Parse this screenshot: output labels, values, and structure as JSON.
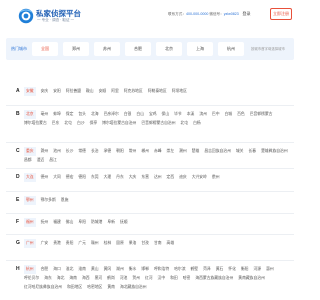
{
  "header": {
    "title": "私家侦探平台",
    "subtitle": "一 专业 · 调查 · 取证 一",
    "contact_prefix": "联系方式：",
    "phone": "400-000-0000",
    "email_prefix": "  微信号：",
    "email": "yzlw0823",
    "login_label": "登录",
    "register_label": "立即注册"
  },
  "hotbar": {
    "label": "热门城市",
    "cities": [
      {
        "name": "全国",
        "active": true
      },
      {
        "name": "郑州",
        "active": false
      },
      {
        "name": "苏州",
        "active": false
      },
      {
        "name": "合肥",
        "active": false
      },
      {
        "name": "北京",
        "active": false
      },
      {
        "name": "上海",
        "active": false
      },
      {
        "name": "杭州",
        "active": false
      }
    ],
    "note": "按城市首字母选择城市"
  },
  "rows": [
    {
      "letter": "A",
      "cities": [
        "安徽",
        "安庆",
        "安阳",
        "阿拉善盟",
        "鞍山",
        "安顺",
        "阿里",
        "阿克苏地区",
        "阿勒泰地区",
        "阿坝地区"
      ]
    },
    {
      "letter": "B",
      "cities": [
        "北京",
        "亳州",
        "蚌埠",
        "保定",
        "包头",
        "北海",
        "巴彦淖尔",
        "白银",
        "白山",
        "宝鸡",
        "保山",
        "毕节",
        "本溪",
        "滨州",
        "巴中",
        "白城",
        "百色",
        "巴音郭楞蒙古",
        "博尔塔拉蒙古",
        "巴东",
        "北屯",
        "白沙",
        "保亭",
        "博尔塔拉蒙古自治州",
        "巴音郭楞蒙古自治州",
        "北屯",
        "白杨"
      ]
    },
    {
      "letter": "C",
      "cities": [
        "重庆",
        "滁州",
        "池州",
        "长沙",
        "常德",
        "长治",
        "承德",
        "朝阳",
        "常州",
        "郴州",
        "赤峰",
        "崇左",
        "潮州",
        "楚雄",
        "昌吉回族自治州",
        "城关",
        "长春",
        "楚雄彝族自治州",
        "昌都",
        "澄迈",
        "昌江"
      ]
    },
    {
      "letter": "D",
      "cities": [
        "大连",
        "德州",
        "大同",
        "德宏",
        "德阳",
        "东莞",
        "大理",
        "丹东",
        "大庆",
        "东营",
        "达州",
        "定西",
        "迪庆",
        "大兴安岭",
        "儋州"
      ]
    },
    {
      "letter": "E",
      "cities": [
        "鄂州",
        "鄂尔多斯",
        "恩施"
      ]
    },
    {
      "letter": "F",
      "cities": [
        "福州",
        "抚州",
        "福建",
        "佛山",
        "阜阳",
        "防城港",
        "阜新",
        "抚顺"
      ]
    },
    {
      "letter": "G",
      "cities": [
        "广州",
        "广安",
        "贵港",
        "贵阳",
        "广元",
        "赣州",
        "桂林",
        "固原",
        "果洛",
        "甘孜",
        "甘南",
        "高雄"
      ]
    },
    {
      "letter": "H",
      "cities": [
        "杭州",
        "合肥",
        "海口",
        "淮北",
        "淮南",
        "黄山",
        "黄冈",
        "湖州",
        "衡水",
        "邯郸",
        "呼和浩特",
        "哈尔滨",
        "鹤壁",
        "菏泽",
        "黄石",
        "怀化",
        "衡阳",
        "河源",
        "惠州",
        "呼伦贝尔",
        "海东",
        "海北",
        "海南",
        "海西",
        "黑河",
        "鹤岗",
        "河池",
        "贺州",
        "红河",
        "汉中",
        "和田",
        "哈密",
        "海西蒙古族藏族自治州",
        "黄南藏族自治州",
        "红河哈尼族彝族自治州",
        "和田地区",
        "哈密地区",
        "黄南",
        "海北藏族自治州"
      ]
    }
  ]
}
